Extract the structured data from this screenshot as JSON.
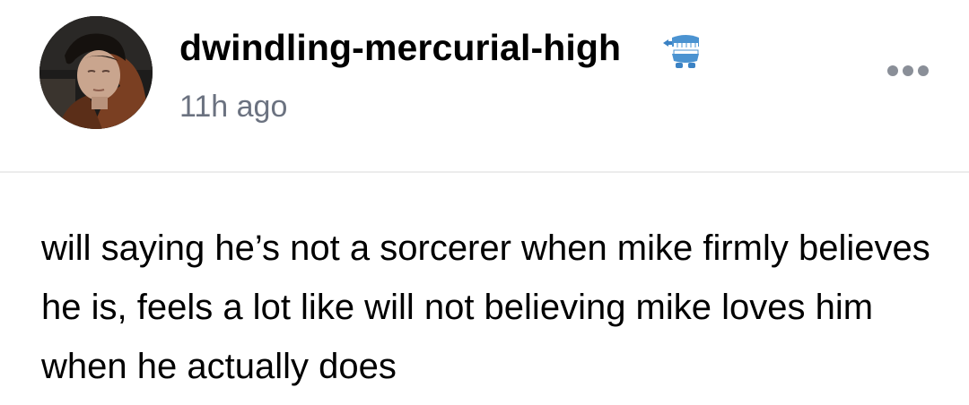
{
  "post": {
    "author": {
      "username": "dwindling-mercurial-high",
      "badge_icon": "chattering-teeth-icon"
    },
    "timestamp": "11h ago",
    "menu_icon": "more-options-icon",
    "body": "will saying he’s not a sorcerer when mike firmly believes he is, feels a lot like will not believing mike loves him when he actually does"
  },
  "colors": {
    "text": "#000000",
    "timestamp": "#6b7280",
    "divider": "#ececec",
    "menu_dots": "#8a8f98",
    "badge": "#3b82c4"
  }
}
